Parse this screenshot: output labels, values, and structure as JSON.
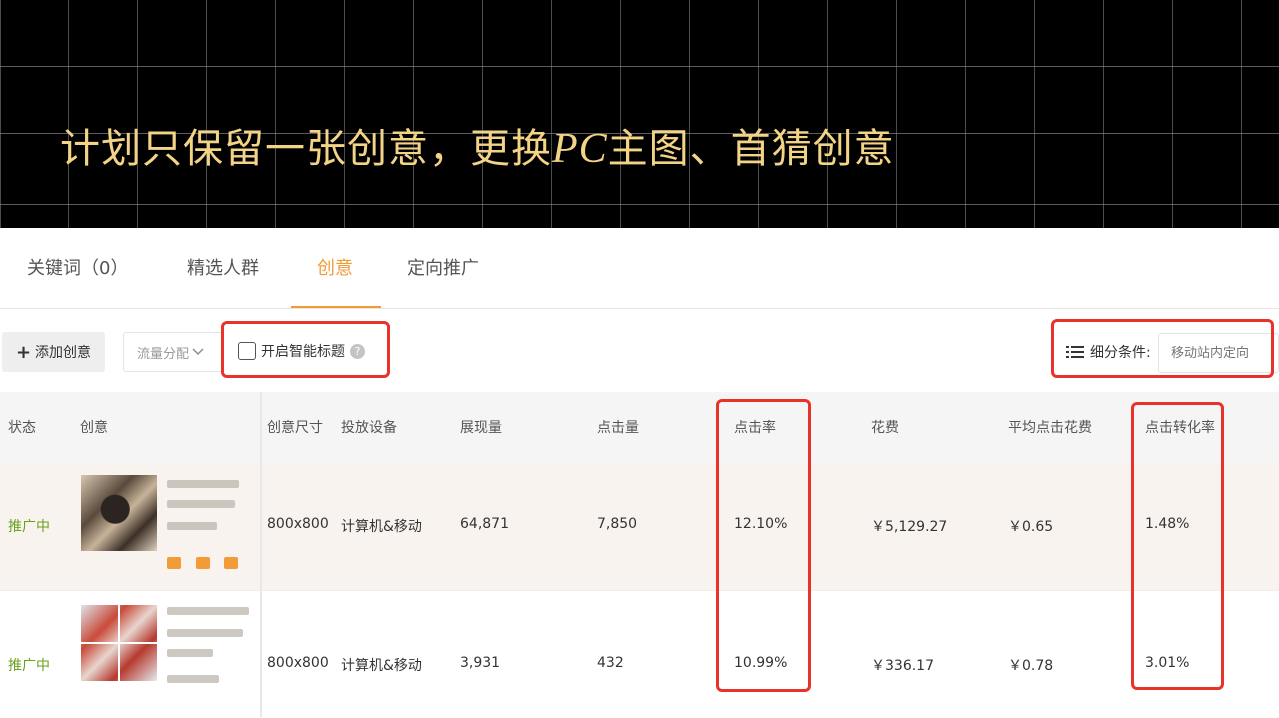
{
  "banner": {
    "title_part1": "计划只保留一张创意，更换",
    "title_pc": "PC",
    "title_part2": "主图、首猜创意"
  },
  "tabs": [
    {
      "label": "关键词（0）",
      "active": false
    },
    {
      "label": "精选人群",
      "active": false
    },
    {
      "label": "创意",
      "active": true
    },
    {
      "label": "定向推广",
      "active": false
    }
  ],
  "toolbar": {
    "add_label": "添加创意",
    "flow_label": "流量分配",
    "smart_title_label": "开启智能标题",
    "filter_label": "细分条件:",
    "filter_placeholder": "移动站内定向"
  },
  "table": {
    "columns": [
      "状态",
      "创意",
      "创意尺寸",
      "投放设备",
      "展现量",
      "点击量",
      "点击率",
      "花费",
      "平均点击花费",
      "点击转化率"
    ],
    "rows": [
      {
        "status": "推广中",
        "size": "800x800",
        "device": "计算机&移动",
        "impressions": "64,871",
        "clicks": "7,850",
        "ctr": "12.10%",
        "cost": "￥5,129.27",
        "cpc": "￥0.65",
        "cvr": "1.48%"
      },
      {
        "status": "推广中",
        "size": "800x800",
        "device": "计算机&移动",
        "impressions": "3,931",
        "clicks": "432",
        "ctr": "10.99%",
        "cost": "￥336.17",
        "cpc": "￥0.78",
        "cvr": "3.01%"
      }
    ]
  },
  "colors": {
    "accent": "#f29c38",
    "banner_text": "#f3d486",
    "status_green": "#6aa11f",
    "annotation_red": "#e8322a"
  }
}
